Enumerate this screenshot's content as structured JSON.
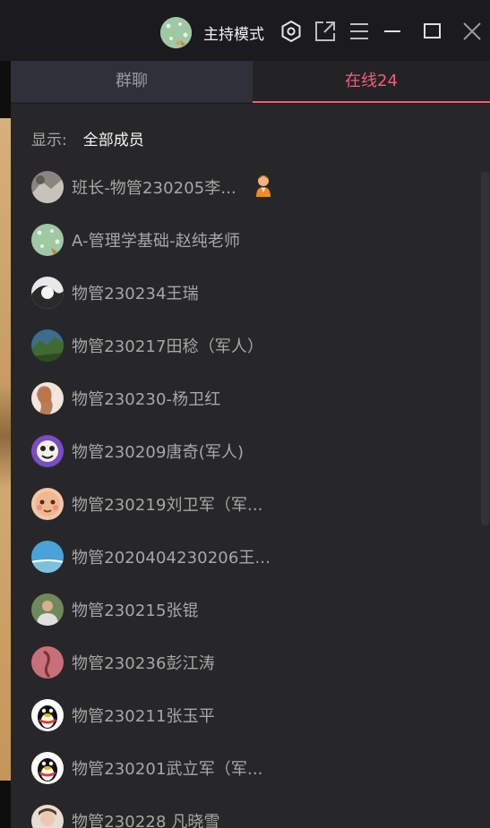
{
  "titlebar": {
    "host_mode_label": "主持模式",
    "icons": [
      "host-avatar",
      "settings-icon",
      "popout-icon",
      "menu-icon",
      "minimize-icon",
      "maximize-icon",
      "close-icon"
    ]
  },
  "tabs": [
    {
      "label": "群聊",
      "selected": false
    },
    {
      "label": "在线24",
      "selected": true
    }
  ],
  "filter": {
    "label": "显示:",
    "value": "全部成员"
  },
  "colors": {
    "accent": "#f25d78",
    "panel_bg": "#272729",
    "text_muted": "#a7a7a7"
  },
  "members": [
    {
      "name": "班长-物管230205李...",
      "avatar": "photo-gray",
      "badge": "monitor-badge-icon"
    },
    {
      "name": "A-管理学基础-赵纯老师",
      "avatar": "green-pattern"
    },
    {
      "name": "物管230234王瑞",
      "avatar": "black-white"
    },
    {
      "name": "物管230217田稔（军人）",
      "avatar": "landscape"
    },
    {
      "name": "物管230230-杨卫红",
      "avatar": "portrait-light"
    },
    {
      "name": "物管230209唐奇(军人)",
      "avatar": "cartoon-purple"
    },
    {
      "name": "物管230219刘卫军（军...",
      "avatar": "cartoon-face"
    },
    {
      "name": "物管2020404230206王...",
      "avatar": "sky-sea"
    },
    {
      "name": "物管230215张锟",
      "avatar": "portrait-outdoor"
    },
    {
      "name": "物管230236彭江涛",
      "avatar": "pink-photo"
    },
    {
      "name": "物管230211张玉平",
      "avatar": "qq-penguin"
    },
    {
      "name": "物管230201武立军（军...",
      "avatar": "qq-penguin"
    },
    {
      "name": "物管230228 凡晓雪",
      "avatar": "portrait-light"
    }
  ]
}
